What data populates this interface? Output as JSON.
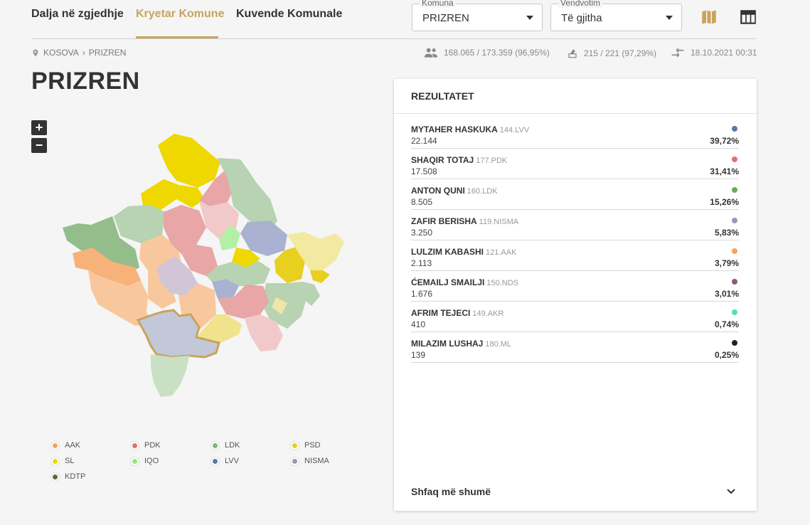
{
  "nav": {
    "tabs": [
      {
        "label": "Dalja në zgjedhje"
      },
      {
        "label": "Kryetar Komune"
      },
      {
        "label": "Kuvende Komunale"
      }
    ]
  },
  "filters": {
    "municipality": {
      "legend": "Komuna",
      "value": "PRIZREN"
    },
    "polling": {
      "legend": "Vendvotim",
      "value": "Të gjitha"
    }
  },
  "breadcrumb": {
    "root": "KOSOVA",
    "current": "PRIZREN"
  },
  "stats": {
    "turnout": "168.065 / 173.359 (96,95%)",
    "stations": "215 / 221 (97,29%)",
    "updated": "18.10.2021 00:31"
  },
  "page_title": "PRIZREN",
  "zoom": {
    "in": "+",
    "out": "−"
  },
  "legend": [
    {
      "label": "AAK",
      "color": "#f7a25c"
    },
    {
      "label": "PDK",
      "color": "#e07070"
    },
    {
      "label": "LDK",
      "color": "#7fb77e"
    },
    {
      "label": "PSD",
      "color": "#e8cf20"
    },
    {
      "label": "SL",
      "color": "#eed800"
    },
    {
      "label": "IQO",
      "color": "#8ce87a"
    },
    {
      "label": "LVV",
      "color": "#5a77a8"
    },
    {
      "label": "NISMA",
      "color": "#a891a8"
    },
    {
      "label": "KDTP",
      "color": "#5f6b2e"
    }
  ],
  "results": {
    "title": "REZULTATET",
    "rows": [
      {
        "name": "MYTAHER HASKUKA",
        "party": "144.LVV",
        "votes": "22.144",
        "pct": "39,72%",
        "color": "#5a77a8"
      },
      {
        "name": "SHAQIR TOTAJ",
        "party": "177.PDK",
        "votes": "17.508",
        "pct": "31,41%",
        "color": "#e07070"
      },
      {
        "name": "ANTON QUNI",
        "party": "160.LDK",
        "votes": "8.505",
        "pct": "15,26%",
        "color": "#6aab56"
      },
      {
        "name": "ZAFIR BERISHA",
        "party": "119.NISMA",
        "votes": "3.250",
        "pct": "5,83%",
        "color": "#a891b6"
      },
      {
        "name": "LULZIM KABASHI",
        "party": "121.AAK",
        "votes": "2.113",
        "pct": "3,79%",
        "color": "#f7a25c"
      },
      {
        "name": "ĆEMAILJ SMAILJI",
        "party": "150.NDS",
        "votes": "1.676",
        "pct": "3,01%",
        "color": "#8c5a80"
      },
      {
        "name": "AFRIM TEJECI",
        "party": "149.AKR",
        "votes": "410",
        "pct": "0,74%",
        "color": "#52e3a8"
      },
      {
        "name": "MILAZIM LUSHAJ",
        "party": "180.ML",
        "votes": "139",
        "pct": "0,25%",
        "color": "#222222"
      }
    ],
    "show_more": "Shfaq më shumë"
  }
}
